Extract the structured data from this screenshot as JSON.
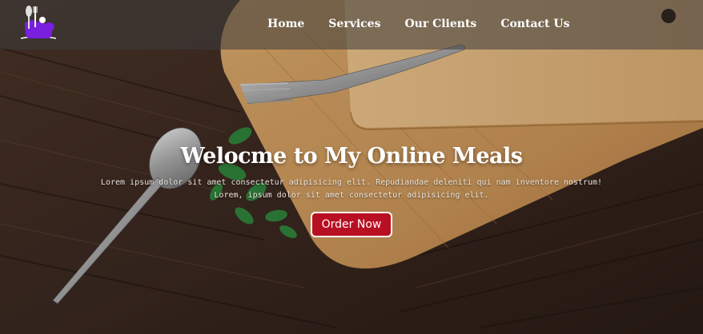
{
  "brand": {
    "logo_icon": "chef-utensils-logo",
    "logo_color": "#7a1fe0"
  },
  "nav": {
    "items": [
      {
        "label": "Home"
      },
      {
        "label": "Services"
      },
      {
        "label": "Our Clients"
      },
      {
        "label": "Contact Us"
      }
    ]
  },
  "hero": {
    "title": "Welocme to My Online Meals",
    "description": "Lorem ipsum dolor sit amet consectetur adipisicing elit. Repudiandae deleniti qui nam inventore nostrum! Lorem, ipsum dolor sit amet consectetur adipisicing elit.",
    "cta_label": "Order Now",
    "cta_color": "#b90f22"
  }
}
